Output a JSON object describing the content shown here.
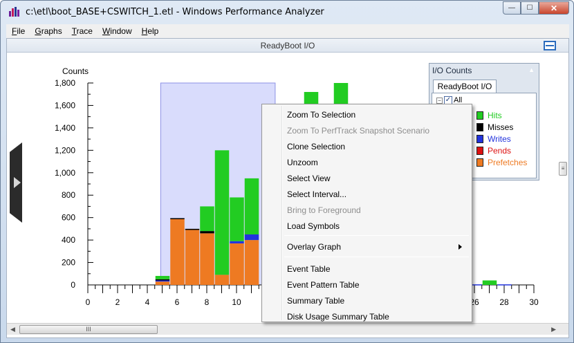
{
  "window": {
    "title": "c:\\etl\\boot_BASE+CSWITCH_1.etl - Windows Performance Analyzer",
    "buttons": {
      "minimize": "—",
      "maximize": "☐",
      "close": "✕"
    }
  },
  "menubar": {
    "items": [
      {
        "accel": "F",
        "rest": "ile"
      },
      {
        "accel": "G",
        "rest": "raphs"
      },
      {
        "accel": "T",
        "rest": "race"
      },
      {
        "accel": "W",
        "rest": "indow"
      },
      {
        "accel": "H",
        "rest": "elp"
      }
    ]
  },
  "graph": {
    "title": "ReadyBoot I/O"
  },
  "legend": {
    "title": "I/O Counts",
    "tab": "ReadyBoot I/O",
    "all_label": "All",
    "all_checked": "✓",
    "expander": "−",
    "caret": "▲",
    "items": [
      {
        "label": "Hits",
        "color": "#22cc22"
      },
      {
        "label": "Misses",
        "color": "#000000"
      },
      {
        "label": "Writes",
        "color": "#2233dd"
      },
      {
        "label": "Pends",
        "color": "#dd1111"
      },
      {
        "label": "Prefetches",
        "color": "#ee7a22"
      }
    ]
  },
  "scrollbar": {
    "grip": "III",
    "left_arrow": "◀",
    "right_arrow": "▶",
    "v_grip": "≡"
  },
  "context_menu": {
    "items": [
      {
        "label": "Zoom To Selection",
        "disabled": false
      },
      {
        "label": "Zoom To PerfTrack Snapshot Scenario",
        "disabled": true
      },
      {
        "label": "Clone Selection",
        "disabled": false
      },
      {
        "label": "Unzoom",
        "disabled": false
      },
      {
        "label": "Select View",
        "disabled": false
      },
      {
        "label": "Select Interval...",
        "disabled": false
      },
      {
        "label": "Bring to Foreground",
        "disabled": true
      },
      {
        "label": "Load Symbols",
        "disabled": false
      },
      {
        "label": "Overlay Graph",
        "disabled": false,
        "submenu": true
      },
      {
        "label": "Event Table",
        "disabled": false
      },
      {
        "label": "Event Pattern Table",
        "disabled": false
      },
      {
        "label": "Summary Table",
        "disabled": false
      },
      {
        "label": "Disk Usage Summary Table",
        "disabled": false
      }
    ]
  },
  "chart_data": {
    "type": "bar",
    "ylabel": "Counts",
    "ylim": [
      0,
      1800
    ],
    "xlim": [
      0,
      30
    ],
    "y_ticks": [
      "0",
      "200",
      "400",
      "600",
      "800",
      "1,000",
      "1,200",
      "1,400",
      "1,600",
      "1,800"
    ],
    "x_ticks": [
      "0",
      "2",
      "4",
      "6",
      "8",
      "10",
      "26",
      "28",
      "30"
    ],
    "x_tick_values": [
      0,
      2,
      4,
      6,
      8,
      10,
      26,
      28,
      30
    ],
    "selection_range": [
      4.9,
      12.6
    ],
    "stack_order": [
      "Prefetches",
      "Pends",
      "Writes",
      "Misses",
      "Hits"
    ],
    "bars": [
      {
        "x": 5,
        "Prefetches": 30,
        "Pends": 0,
        "Writes": 10,
        "Misses": 10,
        "Hits": 30
      },
      {
        "x": 6,
        "Prefetches": 590,
        "Pends": 0,
        "Writes": 0,
        "Misses": 5,
        "Hits": 0
      },
      {
        "x": 7,
        "Prefetches": 490,
        "Pends": 0,
        "Writes": 0,
        "Misses": 10,
        "Hits": 0
      },
      {
        "x": 8,
        "Prefetches": 460,
        "Pends": 0,
        "Writes": 0,
        "Misses": 20,
        "Hits": 220
      },
      {
        "x": 9,
        "Prefetches": 90,
        "Pends": 0,
        "Writes": 0,
        "Misses": 0,
        "Hits": 1110
      },
      {
        "x": 10,
        "Prefetches": 370,
        "Pends": 0,
        "Writes": 20,
        "Misses": 0,
        "Hits": 390
      },
      {
        "x": 11,
        "Prefetches": 400,
        "Pends": 0,
        "Writes": 50,
        "Misses": 0,
        "Hits": 500
      },
      {
        "x": 15,
        "Prefetches": 0,
        "Pends": 0,
        "Writes": 0,
        "Misses": 0,
        "Hits": 1720
      },
      {
        "x": 17,
        "Prefetches": 0,
        "Pends": 0,
        "Writes": 0,
        "Misses": 0,
        "Hits": 1800
      },
      {
        "x": 26,
        "Prefetches": 0,
        "Pends": 0,
        "Writes": 5,
        "Misses": 0,
        "Hits": 0
      },
      {
        "x": 27,
        "Prefetches": 0,
        "Pends": 0,
        "Writes": 0,
        "Misses": 0,
        "Hits": 40
      },
      {
        "x": 28,
        "Prefetches": 0,
        "Pends": 0,
        "Writes": 5,
        "Misses": 0,
        "Hits": 0
      }
    ]
  }
}
